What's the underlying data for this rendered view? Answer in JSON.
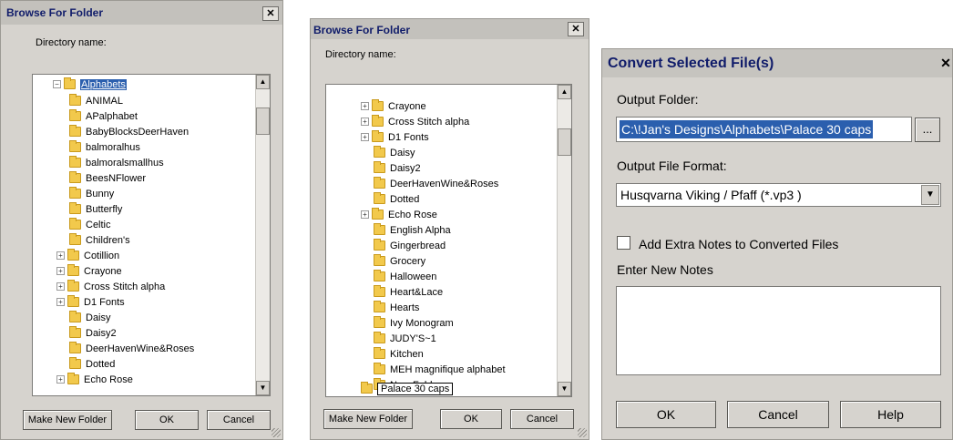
{
  "dialog1": {
    "title": "Browse For Folder",
    "close_glyph": "✕",
    "directory_label": "Directory name:",
    "selected_item": "Alphabets",
    "items": [
      {
        "label": "ANIMAL",
        "expandable": false
      },
      {
        "label": "APalphabet",
        "expandable": false
      },
      {
        "label": "BabyBlocksDeerHaven",
        "expandable": false
      },
      {
        "label": "balmoralhus",
        "expandable": false
      },
      {
        "label": "balmoralsmallhus",
        "expandable": false
      },
      {
        "label": "BeesNFlower",
        "expandable": false
      },
      {
        "label": "Bunny",
        "expandable": false
      },
      {
        "label": "Butterfly",
        "expandable": false
      },
      {
        "label": "Celtic",
        "expandable": false
      },
      {
        "label": "Children's",
        "expandable": false
      },
      {
        "label": "Cotillion",
        "expandable": true
      },
      {
        "label": "Crayone",
        "expandable": true
      },
      {
        "label": "Cross Stitch alpha",
        "expandable": true
      },
      {
        "label": "D1 Fonts",
        "expandable": true
      },
      {
        "label": "Daisy",
        "expandable": false
      },
      {
        "label": "Daisy2",
        "expandable": false
      },
      {
        "label": "DeerHavenWine&Roses",
        "expandable": false
      },
      {
        "label": "Dotted",
        "expandable": false
      },
      {
        "label": "Echo Rose",
        "expandable": true
      }
    ],
    "make_new_folder": "Make New Folder",
    "ok": "OK",
    "cancel": "Cancel"
  },
  "dialog2": {
    "title": "Browse For Folder",
    "close_glyph": "✕",
    "directory_label": "Directory name:",
    "items": [
      {
        "label": "Crayone",
        "expandable": true
      },
      {
        "label": "Cross Stitch alpha",
        "expandable": true
      },
      {
        "label": "D1 Fonts",
        "expandable": true
      },
      {
        "label": "Daisy",
        "expandable": false
      },
      {
        "label": "Daisy2",
        "expandable": false
      },
      {
        "label": "DeerHavenWine&Roses",
        "expandable": false
      },
      {
        "label": "Dotted",
        "expandable": false
      },
      {
        "label": "Echo Rose",
        "expandable": true
      },
      {
        "label": "English Alpha",
        "expandable": false
      },
      {
        "label": "Gingerbread",
        "expandable": false
      },
      {
        "label": "Grocery",
        "expandable": false
      },
      {
        "label": "Halloween",
        "expandable": false
      },
      {
        "label": "Heart&Lace",
        "expandable": false
      },
      {
        "label": "Hearts",
        "expandable": false
      },
      {
        "label": "Ivy Monogram",
        "expandable": false
      },
      {
        "label": "JUDY'S~1",
        "expandable": false
      },
      {
        "label": "Kitchen",
        "expandable": false
      },
      {
        "label": "MEH magnifique alphabet",
        "expandable": false
      },
      {
        "label": "New Folder",
        "expandable": false
      }
    ],
    "editing_item": "Palace 30 caps",
    "make_new_folder": "Make New Folder",
    "ok": "OK",
    "cancel": "Cancel"
  },
  "dialog3": {
    "title": "Convert Selected File(s)",
    "close_glyph": "✕",
    "output_folder_label": "Output Folder:",
    "output_folder_value": "C:\\!Jan's Designs\\Alphabets\\Palace 30 caps",
    "browse_label": "...",
    "output_format_label": "Output File Format:",
    "output_format_value": "Husqvarna Viking / Pfaff (*.vp3 )",
    "add_notes_label": "Add Extra Notes to Converted Files",
    "add_notes_checked": false,
    "enter_notes_label": "Enter New Notes",
    "notes_value": "",
    "ok": "OK",
    "cancel": "Cancel",
    "help": "Help"
  }
}
